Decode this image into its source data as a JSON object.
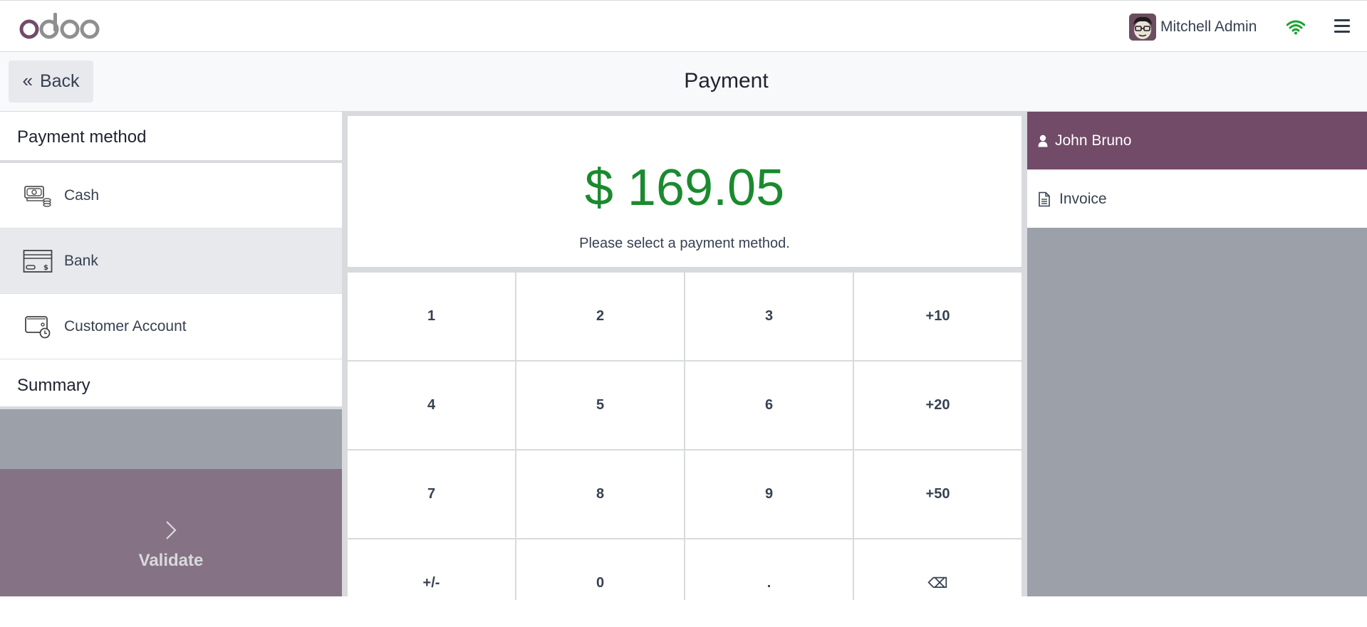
{
  "navbar": {
    "logo_text": "odoo",
    "user_name": "Mitchell Admin",
    "icons": {
      "avatar": "user-avatar",
      "wifi": "wifi-icon",
      "menu": "hamburger-menu-icon"
    },
    "wifi_color": "#17a32e"
  },
  "subheader": {
    "back_label": "Back",
    "back_icon": "double-chevron-left-icon",
    "title": "Payment"
  },
  "left_panel": {
    "payment_method_title": "Payment method",
    "payment_methods": [
      {
        "label": "Cash",
        "icon": "cash-icon",
        "selected": false
      },
      {
        "label": "Bank",
        "icon": "bank-card-icon",
        "selected": true
      },
      {
        "label": "Customer Account",
        "icon": "customer-account-icon",
        "selected": false
      }
    ],
    "summary_title": "Summary",
    "validate_label": "Validate",
    "validate_icon": "chevron-right-icon"
  },
  "center_panel": {
    "amount": "$ 169.05",
    "prompt": "Please select a payment method.",
    "amount_color": "#1b8a2f",
    "numpad": [
      "1",
      "2",
      "3",
      "+10",
      "4",
      "5",
      "6",
      "+20",
      "7",
      "8",
      "9",
      "+50",
      "+/-",
      "0",
      ".",
      "⌫"
    ]
  },
  "right_panel": {
    "customer_name": "John Bruno",
    "customer_icon": "user-icon",
    "invoice_label": "Invoice",
    "invoice_icon": "document-icon",
    "brand_color": "#714b67"
  }
}
